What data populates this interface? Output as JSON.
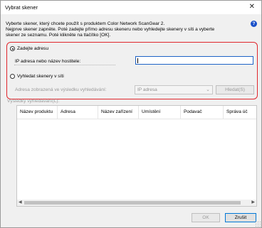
{
  "window": {
    "title": "Vybrat skener"
  },
  "intro": {
    "line1": "Vyberte skener, který chcete použít s produktem Color Network ScanGear 2.",
    "line2": "Nejprve skener zapněte. Poté zadejte přímo adresu skeneru nebo vyhledejte skenery v síti a vyberte",
    "line3": "skener ze seznamu. Poté klikněte na tlačítko [OK]."
  },
  "address_option": {
    "label": "Zadejte adresu",
    "selected": true,
    "field_label": "IP adresa nebo název hostitele:",
    "field_value": ""
  },
  "search_option": {
    "label": "Vyhledat skenery v síti",
    "selected": false,
    "display_label": "Adresa zobrazená ve výsledku vyhledávání:",
    "display_value": "IP adresa",
    "search_button": "Hledat(S)"
  },
  "results": {
    "label": "Výsledky vyhledávání(L):",
    "columns": [
      "Název produktu",
      "Adresa",
      "Název zařízení",
      "Umístění",
      "Podavač",
      "Správa úč"
    ]
  },
  "buttons": {
    "ok": "OK",
    "cancel": "Zrušit"
  },
  "colors": {
    "highlight_border": "#e0262c",
    "focus": "#1e63c7",
    "help_icon": "#1a50c9"
  },
  "icons": {
    "close": "close-icon",
    "help": "help-icon",
    "dropdown": "chevron-down-icon"
  }
}
